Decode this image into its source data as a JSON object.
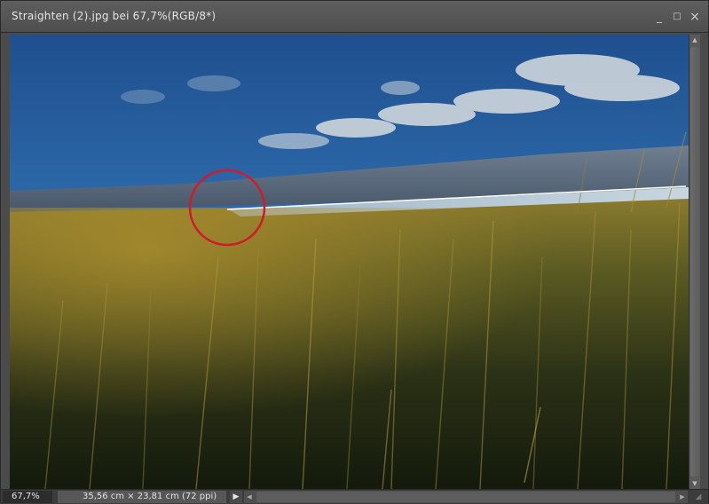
{
  "window": {
    "title": "Straighten (2).jpg bei 67,7%(RGB/8*)",
    "controls": {
      "minimize": "_",
      "maximize": "□",
      "close": "×"
    }
  },
  "status": {
    "zoom": "67,7%",
    "doc_info": "35,56 cm × 23,81 cm (72 ppi)",
    "menu_arrow": "▶"
  },
  "scroll": {
    "up": "▲",
    "down": "▼",
    "left": "◀",
    "right": "▶"
  },
  "icons": {
    "info_arrow": "right-triangle-icon"
  },
  "colors": {
    "highlight_circle": "#d21a2a",
    "straighten_line": "#ffffff"
  }
}
